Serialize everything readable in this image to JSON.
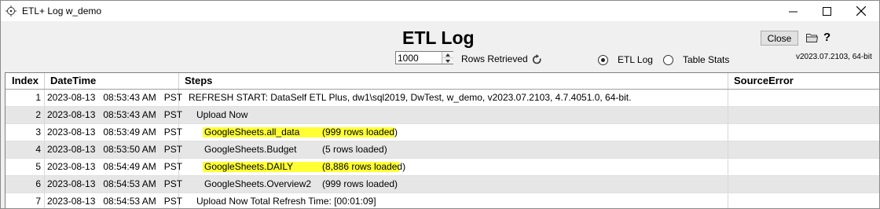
{
  "window": {
    "title": "ETL+ Log w_demo"
  },
  "header": {
    "title": "ETL Log",
    "rows_value": "1000",
    "rows_label": "Rows Retrieved",
    "radio_etl_label": "ETL Log",
    "radio_table_label": "Table Stats",
    "radio_selected": "ETL Log",
    "close_label": "Close",
    "help_label": "?",
    "version": "v2023.07.2103, 64-bit"
  },
  "grid": {
    "columns": [
      "Index",
      "DateTime",
      "Steps",
      "SourceError"
    ],
    "rows": [
      {
        "index": "1",
        "datetime": "2023-08-13   08:53:43 AM   PST",
        "step": "REFRESH START: DataSelf ETL Plus, dw1\\sql2019, DwTest, w_demo, v2023.07.2103, 4.7.4051.0, 64-bit.",
        "rows": "",
        "indent": 0,
        "highlight": false,
        "error": ""
      },
      {
        "index": "2",
        "datetime": "2023-08-13   08:53:43 AM   PST",
        "step": "Upload Now",
        "rows": "",
        "indent": 1,
        "highlight": false,
        "error": ""
      },
      {
        "index": "3",
        "datetime": "2023-08-13   08:53:49 AM   PST",
        "step": "GoogleSheets.all_data",
        "rows": "(999 rows loaded)",
        "indent": 2,
        "highlight": true,
        "error": ""
      },
      {
        "index": "4",
        "datetime": "2023-08-13   08:53:50 AM   PST",
        "step": "GoogleSheets.Budget",
        "rows": "(5 rows loaded)",
        "indent": 2,
        "highlight": false,
        "error": ""
      },
      {
        "index": "5",
        "datetime": "2023-08-13   08:54:49 AM   PST",
        "step": "GoogleSheets.DAILY",
        "rows": "(8,886 rows loaded)",
        "indent": 2,
        "highlight": true,
        "error": ""
      },
      {
        "index": "6",
        "datetime": "2023-08-13   08:54:53 AM   PST",
        "step": "GoogleSheets.Overview2",
        "rows": "(999 rows loaded)",
        "indent": 2,
        "highlight": false,
        "error": ""
      },
      {
        "index": "7",
        "datetime": "2023-08-13   08:54:53 AM   PST",
        "step": "Upload Now Total Refresh Time: [00:01:09]",
        "rows": "",
        "indent": 1,
        "highlight": false,
        "error": ""
      }
    ]
  },
  "colors": {
    "highlight": "#ffff33",
    "alt_row": "#e6e6e6",
    "window_bg": "#f0f0f0"
  }
}
